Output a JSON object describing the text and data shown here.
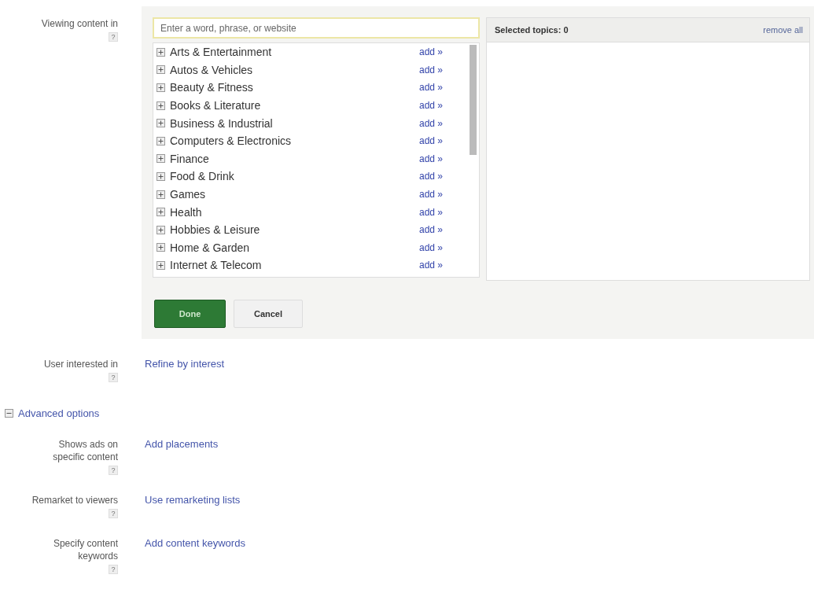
{
  "targeting": {
    "label": "Viewing content in",
    "help": "?",
    "search": {
      "placeholder": "Enter a word, phrase, or website"
    },
    "categories": [
      {
        "name": "Arts & Entertainment",
        "expanded": false,
        "action": "add »"
      },
      {
        "name": "Autos & Vehicles",
        "expanded": false,
        "action": "add »"
      },
      {
        "name": "Beauty & Fitness",
        "expanded": false,
        "action": "add »"
      },
      {
        "name": "Books & Literature",
        "expanded": false,
        "action": "add »"
      },
      {
        "name": "Business & Industrial",
        "expanded": false,
        "action": "add »"
      },
      {
        "name": "Computers & Electronics",
        "expanded": false,
        "action": "add »"
      },
      {
        "name": "Finance",
        "expanded": false,
        "action": "add »"
      },
      {
        "name": "Food & Drink",
        "expanded": false,
        "action": "add »"
      },
      {
        "name": "Games",
        "expanded": false,
        "action": "add »"
      },
      {
        "name": "Health",
        "expanded": false,
        "action": "add »"
      },
      {
        "name": "Hobbies & Leisure",
        "expanded": false,
        "action": "add »"
      },
      {
        "name": "Home & Garden",
        "expanded": false,
        "action": "add »"
      },
      {
        "name": "Internet & Telecom",
        "expanded": false,
        "action": "add »"
      }
    ],
    "selected_panel": {
      "title": "Selected topics: 0",
      "action": "remove all"
    },
    "buttons": [
      {
        "label": "Done",
        "kind": "primary"
      },
      {
        "label": "Cancel",
        "kind": "secondary"
      }
    ]
  },
  "options": [
    {
      "label": "User interested in",
      "help": "?",
      "link": "Refine by interest"
    }
  ],
  "advanced": {
    "label": "Advanced options",
    "expanded": true,
    "options": [
      {
        "label": "Shows ads on specific content",
        "help": "?",
        "link": "Add placements"
      },
      {
        "label": "Remarket to viewers",
        "help": "?",
        "link": "Use remarketing lists"
      },
      {
        "label": "Specify content keywords",
        "help": "?",
        "link": "Add content keywords"
      }
    ]
  }
}
